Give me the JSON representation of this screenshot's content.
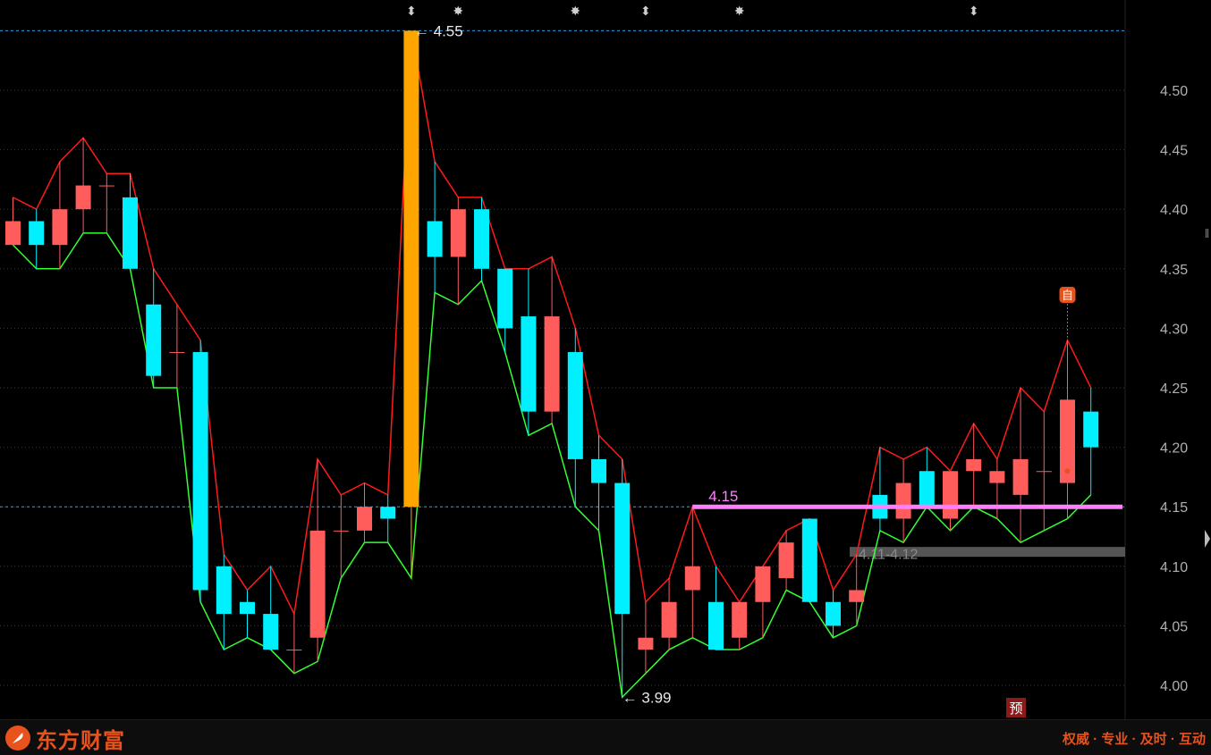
{
  "chart_data": {
    "type": "candlestick",
    "ylim": [
      3.975,
      4.575
    ],
    "y_ticks": [
      "4.00",
      "4.05",
      "4.10",
      "4.15",
      "4.20",
      "4.25",
      "4.30",
      "4.35",
      "4.40",
      "4.45",
      "4.50"
    ],
    "up_color": "#ff5c5c",
    "down_color": "#00f0ff",
    "upper_line_color": "#ff1a1a",
    "lower_line_color": "#33ff33",
    "candles": [
      {
        "o": 4.37,
        "h": 4.41,
        "l": 4.37,
        "c": 4.39
      },
      {
        "o": 4.39,
        "h": 4.4,
        "l": 4.35,
        "c": 4.37
      },
      {
        "o": 4.37,
        "h": 4.44,
        "l": 4.35,
        "c": 4.4
      },
      {
        "o": 4.4,
        "h": 4.46,
        "l": 4.38,
        "c": 4.42
      },
      {
        "o": 4.42,
        "h": 4.43,
        "l": 4.38,
        "c": 4.42
      },
      {
        "o": 4.41,
        "h": 4.43,
        "l": 4.35,
        "c": 4.35
      },
      {
        "o": 4.32,
        "h": 4.35,
        "l": 4.25,
        "c": 4.26
      },
      {
        "o": 4.28,
        "h": 4.32,
        "l": 4.25,
        "c": 4.28
      },
      {
        "o": 4.28,
        "h": 4.29,
        "l": 4.07,
        "c": 4.08
      },
      {
        "o": 4.1,
        "h": 4.11,
        "l": 4.03,
        "c": 4.06
      },
      {
        "o": 4.07,
        "h": 4.08,
        "l": 4.04,
        "c": 4.06
      },
      {
        "o": 4.06,
        "h": 4.1,
        "l": 4.03,
        "c": 4.03
      },
      {
        "o": 4.03,
        "h": 4.06,
        "l": 4.01,
        "c": 4.03
      },
      {
        "o": 4.04,
        "h": 4.19,
        "l": 4.02,
        "c": 4.13
      },
      {
        "o": 4.13,
        "h": 4.16,
        "l": 4.09,
        "c": 4.13
      },
      {
        "o": 4.13,
        "h": 4.17,
        "l": 4.12,
        "c": 4.15
      },
      {
        "o": 4.15,
        "h": 4.16,
        "l": 4.12,
        "c": 4.14
      },
      {
        "o": 4.15,
        "h": 4.55,
        "l": 4.09,
        "c": 4.55,
        "highlight": true
      },
      {
        "o": 4.39,
        "h": 4.44,
        "l": 4.33,
        "c": 4.36
      },
      {
        "o": 4.36,
        "h": 4.41,
        "l": 4.32,
        "c": 4.4
      },
      {
        "o": 4.4,
        "h": 4.41,
        "l": 4.34,
        "c": 4.35
      },
      {
        "o": 4.35,
        "h": 4.35,
        "l": 4.28,
        "c": 4.3
      },
      {
        "o": 4.31,
        "h": 4.35,
        "l": 4.21,
        "c": 4.23
      },
      {
        "o": 4.23,
        "h": 4.36,
        "l": 4.22,
        "c": 4.31
      },
      {
        "o": 4.28,
        "h": 4.3,
        "l": 4.15,
        "c": 4.19
      },
      {
        "o": 4.19,
        "h": 4.21,
        "l": 4.13,
        "c": 4.17
      },
      {
        "o": 4.17,
        "h": 4.19,
        "l": 3.99,
        "c": 4.06
      },
      {
        "o": 4.03,
        "h": 4.07,
        "l": 4.01,
        "c": 4.04
      },
      {
        "o": 4.04,
        "h": 4.09,
        "l": 4.03,
        "c": 4.07
      },
      {
        "o": 4.08,
        "h": 4.15,
        "l": 4.04,
        "c": 4.1
      },
      {
        "o": 4.07,
        "h": 4.1,
        "l": 4.03,
        "c": 4.03
      },
      {
        "o": 4.04,
        "h": 4.07,
        "l": 4.03,
        "c": 4.07
      },
      {
        "o": 4.07,
        "h": 4.1,
        "l": 4.04,
        "c": 4.1
      },
      {
        "o": 4.09,
        "h": 4.13,
        "l": 4.08,
        "c": 4.12
      },
      {
        "o": 4.14,
        "h": 4.14,
        "l": 4.07,
        "c": 4.07
      },
      {
        "o": 4.07,
        "h": 4.08,
        "l": 4.04,
        "c": 4.05
      },
      {
        "o": 4.07,
        "h": 4.11,
        "l": 4.05,
        "c": 4.08
      },
      {
        "o": 4.16,
        "h": 4.2,
        "l": 4.13,
        "c": 4.14
      },
      {
        "o": 4.14,
        "h": 4.19,
        "l": 4.12,
        "c": 4.17
      },
      {
        "o": 4.18,
        "h": 4.2,
        "l": 4.15,
        "c": 4.15
      },
      {
        "o": 4.14,
        "h": 4.18,
        "l": 4.13,
        "c": 4.18
      },
      {
        "o": 4.18,
        "h": 4.22,
        "l": 4.15,
        "c": 4.19
      },
      {
        "o": 4.17,
        "h": 4.19,
        "l": 4.14,
        "c": 4.18
      },
      {
        "o": 4.16,
        "h": 4.25,
        "l": 4.12,
        "c": 4.19
      },
      {
        "o": 4.18,
        "h": 4.23,
        "l": 4.13,
        "c": 4.18
      },
      {
        "o": 4.17,
        "h": 4.29,
        "l": 4.14,
        "c": 4.24
      },
      {
        "o": 4.23,
        "h": 4.25,
        "l": 4.16,
        "c": 4.2
      }
    ],
    "reference_price": 4.15,
    "reference_line_label": "4.15",
    "high_marker_label": "4.55",
    "low_marker_label": "3.99",
    "support_band_label": "4.11-4.12",
    "support_band": [
      4.11,
      4.12
    ],
    "top_markers": [
      {
        "index": 17,
        "symbol": "⬍"
      },
      {
        "index": 19,
        "symbol": "✸"
      },
      {
        "index": 24,
        "symbol": "✸"
      },
      {
        "index": 27,
        "symbol": "⬍"
      },
      {
        "index": 31,
        "symbol": "✸"
      },
      {
        "index": 41,
        "symbol": "⬍"
      }
    ],
    "self_marker_label": "自",
    "self_marker_index": 45,
    "forecast_marker_label": "预"
  },
  "footer": {
    "brand_name": "东方财富",
    "slogan": "权威 · 专业 · 及时 · 互动"
  },
  "colors": {
    "brand": "#e8521c",
    "highlight_bar": "#ffa500",
    "reference_line": "#ff7fff",
    "support_band": "#555555"
  }
}
